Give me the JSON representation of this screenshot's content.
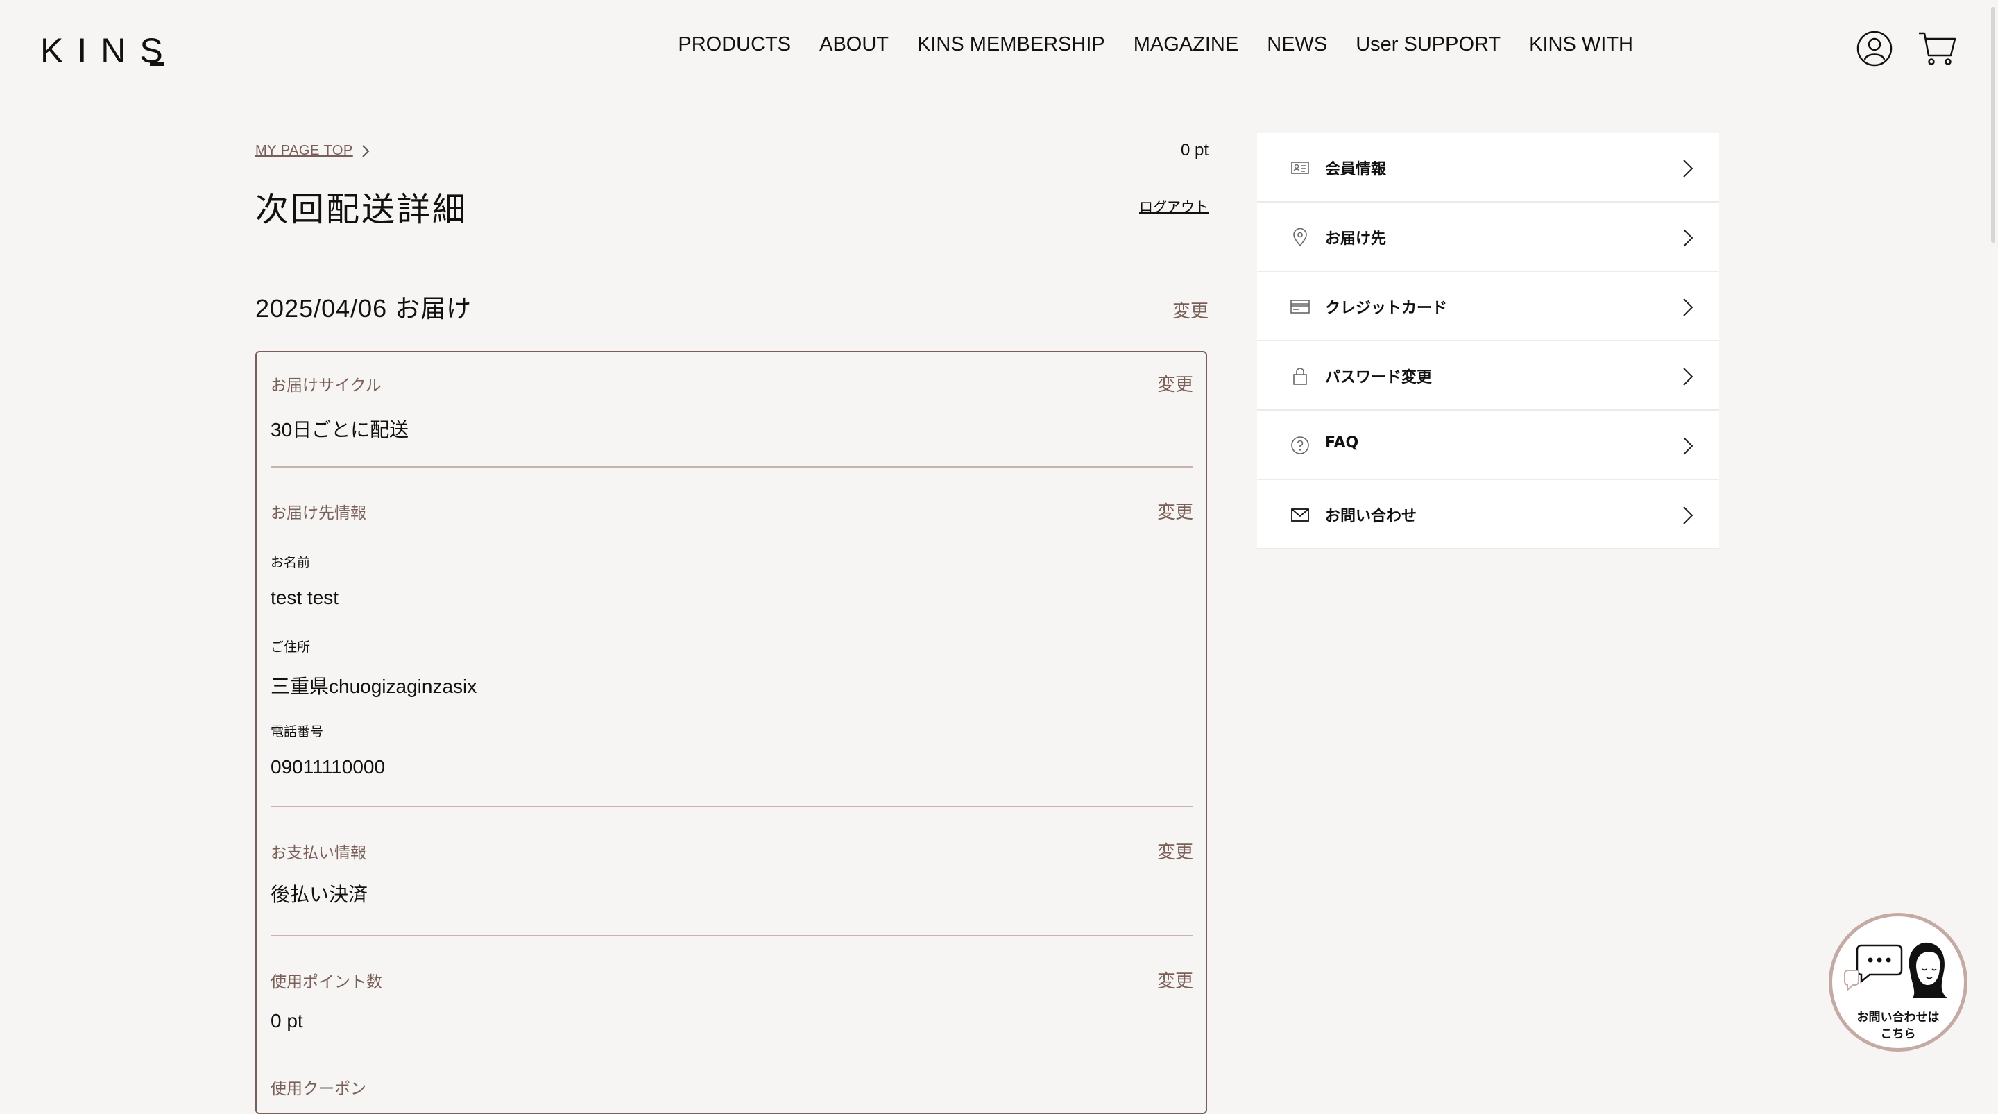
{
  "header": {
    "logo": "KINS",
    "nav": [
      "PRODUCTS",
      "ABOUT",
      "KINS MEMBERSHIP",
      "MAGAZINE",
      "NEWS",
      "User SUPPORT",
      "KINS WITH"
    ]
  },
  "breadcrumb": "MY PAGE TOP",
  "points": "0 pt",
  "page_title": "次回配送詳細",
  "logout": "ログアウト",
  "delivery": {
    "date": "2025/04/06 お届け",
    "change": "変更"
  },
  "card": {
    "cycle": {
      "title": "お届けサイクル",
      "change": "変更",
      "value": "30日ごとに配送"
    },
    "address": {
      "title": "お届け先情報",
      "change": "変更",
      "name_label": "お名前",
      "name": "test test",
      "addr_label": "ご住所",
      "addr": "三重県chuogizaginzasix",
      "tel_label": "電話番号",
      "tel": "09011110000"
    },
    "payment": {
      "title": "お支払い情報",
      "change": "変更",
      "value": "後払い決済"
    },
    "points": {
      "title": "使用ポイント数",
      "change": "変更",
      "value": "0 pt"
    },
    "coupon": {
      "title": "使用クーポン"
    }
  },
  "menu": [
    {
      "label": "会員情報",
      "icon": "id-card-icon"
    },
    {
      "label": "お届け先",
      "icon": "location-pin-icon"
    },
    {
      "label": "クレジットカード",
      "icon": "credit-card-icon"
    },
    {
      "label": "パスワード変更",
      "icon": "lock-icon"
    },
    {
      "label": "FAQ",
      "icon": "question-icon"
    },
    {
      "label": "お問い合わせ",
      "icon": "mail-icon"
    }
  ],
  "chat": {
    "line1": "お問い合わせは",
    "line2": "こちら"
  },
  "colors": {
    "accent": "#7a5f58",
    "background": "#f6f5f3"
  }
}
